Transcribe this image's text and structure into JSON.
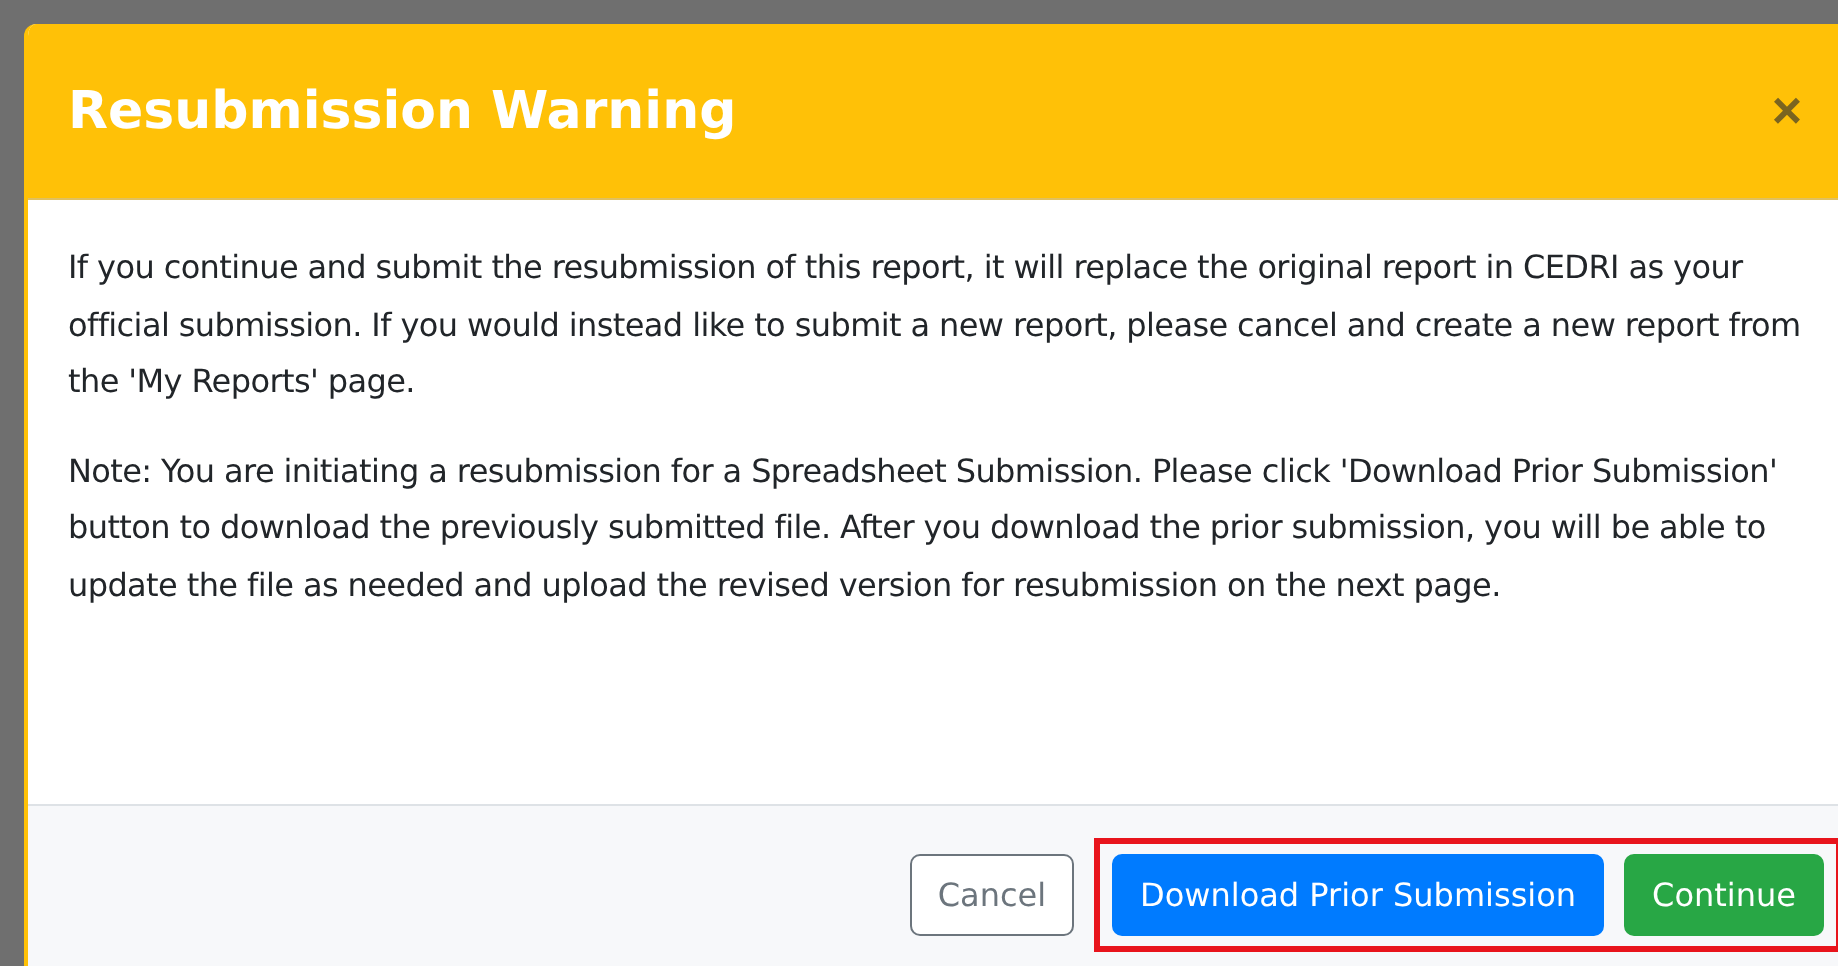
{
  "dialog": {
    "title": "Resubmission Warning",
    "close": "×",
    "paragraphs": [
      "If you continue and submit the resubmission of this report, it will replace the original report in CEDRI as your official submission. If you would instead like to submit a new report, please cancel and create a new report from the 'My Reports' page.",
      "Note: You are initiating a resubmission for a Spreadsheet Submission. Please click 'Download Prior Submission' button to download the previously submitted file. After you download the prior submission, you will be able to update the file as needed and upload the revised version for resubmission on the next page."
    ],
    "buttons": [
      {
        "label": "Cancel",
        "kind": "outline",
        "highlighted": false
      },
      {
        "label": "Download Prior Submission",
        "kind": "primary",
        "highlighted": true
      },
      {
        "label": "Continue",
        "kind": "success",
        "highlighted": true
      }
    ]
  }
}
